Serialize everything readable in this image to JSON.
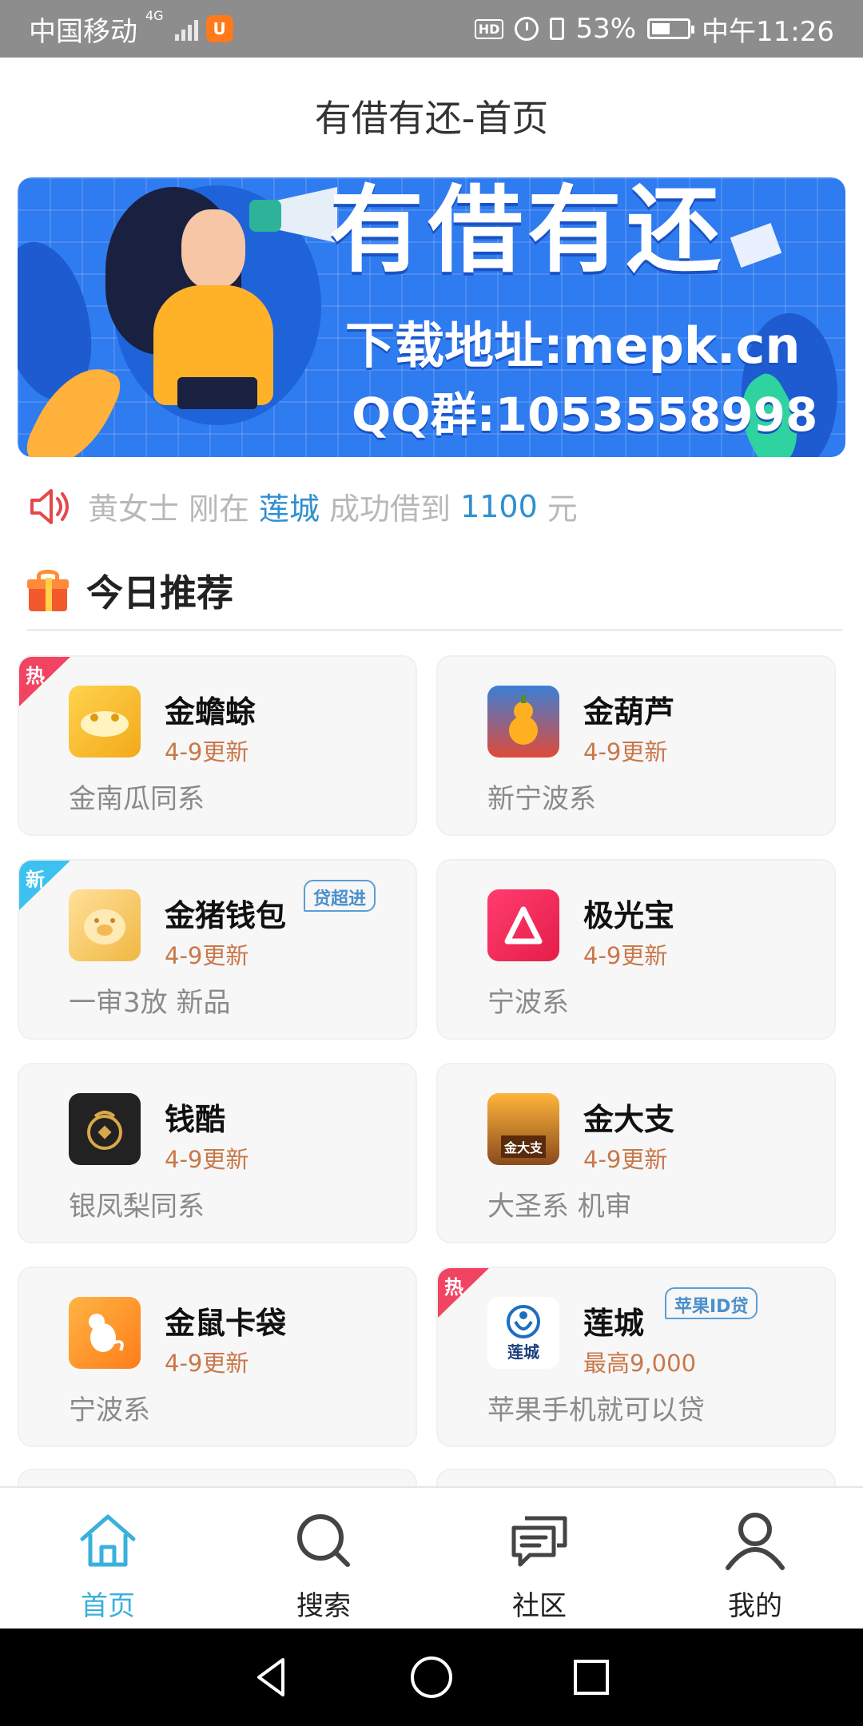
{
  "status_bar": {
    "carrier": "中国移动",
    "network": "4G",
    "battery": "53%",
    "time": "中午11:26",
    "icons": [
      "signal-icon",
      "uc-browser-icon",
      "hd-icon",
      "alarm-icon",
      "vibrate-icon",
      "battery-icon"
    ]
  },
  "header": {
    "title": "有借有还-首页"
  },
  "banner": {
    "title": "有借有还",
    "download": "下载地址:mepk.cn",
    "qq": "QQ群:1053558998"
  },
  "notice": {
    "name": "黄女士",
    "just": "刚在",
    "platform": "莲城",
    "success": "成功借到",
    "amount": "1100",
    "unit": "元"
  },
  "section": {
    "heading": "今日推荐"
  },
  "cards": [
    {
      "name": "金蟾蜍",
      "update": "4-9更新",
      "desc": "金南瓜同系",
      "corner": "热",
      "icon": "golden-toad-icon"
    },
    {
      "name": "金葫芦",
      "update": "4-9更新",
      "desc": "新宁波系",
      "icon": "golden-gourd-icon"
    },
    {
      "name": "金猪钱包",
      "update": "4-9更新",
      "desc": "一审3放 新品",
      "corner": "新",
      "tag": "贷超进",
      "icon": "golden-pig-icon"
    },
    {
      "name": "极光宝",
      "update": "4-9更新",
      "desc": "宁波系",
      "icon": "aurora-icon"
    },
    {
      "name": "钱酷",
      "update": "4-9更新",
      "desc": "银凤梨同系",
      "icon": "coin-pouch-icon"
    },
    {
      "name": "金大支",
      "update": "4-9更新",
      "desc": "大圣系 机审",
      "icon": "treasure-chest-icon",
      "logo_text": "金大支"
    },
    {
      "name": "金鼠卡袋",
      "update": "4-9更新",
      "desc": "宁波系",
      "icon": "mouse-icon"
    },
    {
      "name": "莲城",
      "update": "最高9,000",
      "desc": "苹果手机就可以贷",
      "corner": "热",
      "tag": "苹果ID贷",
      "icon": "liancheng-icon",
      "logo_text": "莲城"
    }
  ],
  "bottom_nav": [
    {
      "label": "首页",
      "icon": "home-icon",
      "active": true
    },
    {
      "label": "搜索",
      "icon": "search-icon"
    },
    {
      "label": "社区",
      "icon": "chat-icon"
    },
    {
      "label": "我的",
      "icon": "user-icon"
    }
  ],
  "system_nav": [
    "back-icon",
    "home-circle-icon",
    "recents-icon"
  ],
  "colors": {
    "accent": "#3ab0dc",
    "hot": "#f04462",
    "new": "#3cc1f0",
    "update": "#c9784a",
    "banner": "#2f7bf0"
  }
}
